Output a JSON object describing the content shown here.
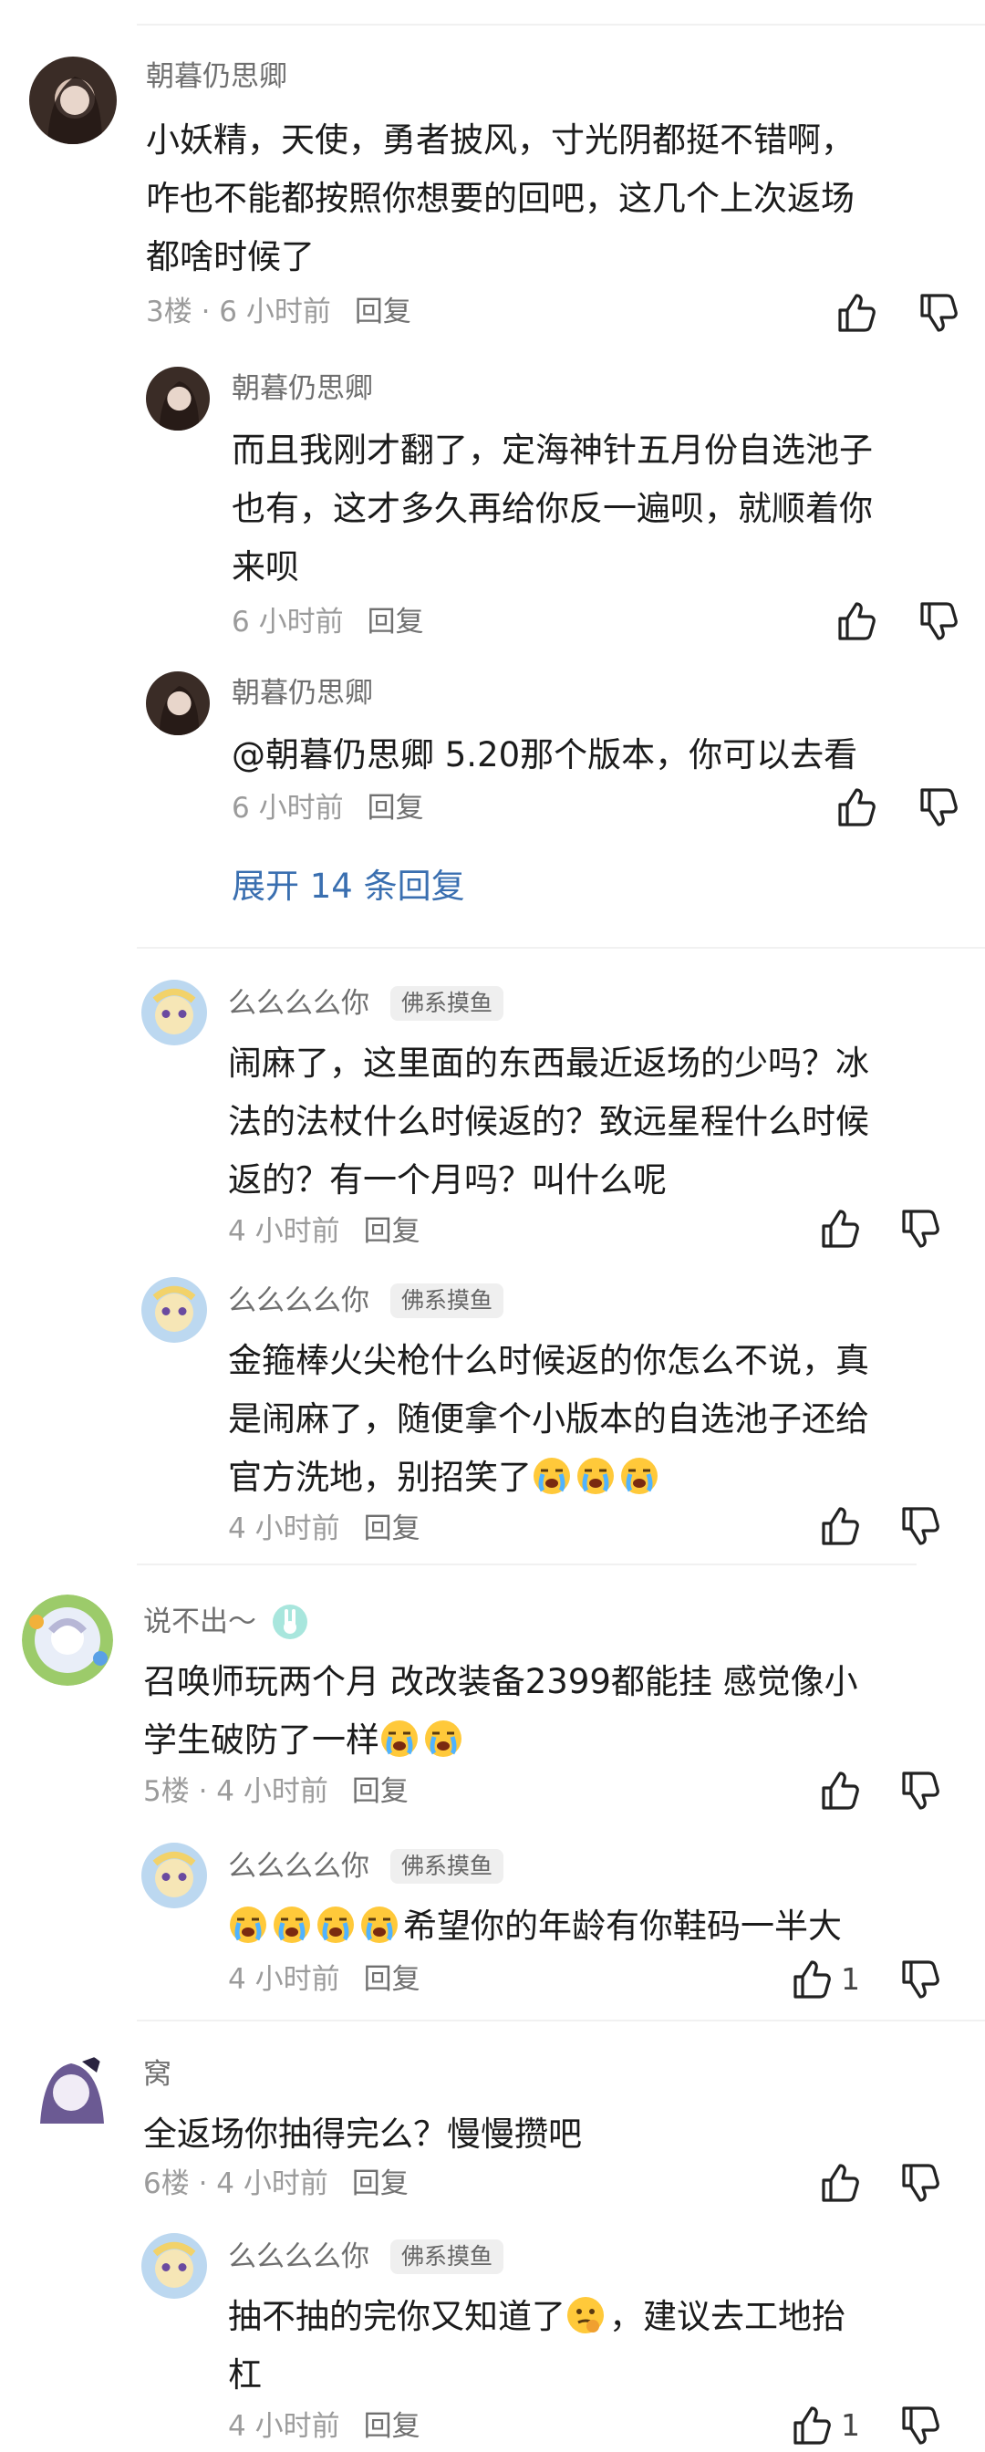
{
  "colors": {
    "link": "#3a6fb0",
    "meta": "#9b9b9b",
    "text": "#1b1b1b"
  },
  "comments": [
    {
      "user": "朝暮仍思卿",
      "lines": [
        "小妖精，天使，勇者披风，寸光阴都挺不错啊，",
        "咋也不能都按照你想要的回吧，这几个上次返场",
        "都啥时候了"
      ],
      "meta": "3楼 · 6 小时前",
      "reply_label": "回复",
      "replies": [
        {
          "user": "朝暮仍思卿",
          "lines": [
            "而且我刚才翻了，定海神针五月份自选池子",
            "也有，这才多久再给你反一遍呗，就顺着你",
            "来呗"
          ],
          "meta": "6 小时前",
          "reply_label": "回复"
        },
        {
          "user": "朝暮仍思卿",
          "lines": [
            "@朝暮仍思卿  5.20那个版本，你可以去看"
          ],
          "meta": "6 小时前",
          "reply_label": "回复"
        }
      ],
      "expand_label": "展开 14 条回复"
    },
    {
      "replies": [
        {
          "user": "么么么么你",
          "badge": "佛系摸鱼",
          "lines": [
            "闹麻了，这里面的东西最近返场的少吗？冰",
            "法的法杖什么时候返的？致远星程什么时候",
            "返的？有一个月吗？叫什么呢"
          ],
          "meta": "4 小时前",
          "reply_label": "回复"
        },
        {
          "user": "么么么么你",
          "badge": "佛系摸鱼",
          "lines": [
            "金箍棒火尖枪什么时候返的你怎么不说，真",
            "是闹麻了，随便拿个小版本的自选池子还给",
            "官方洗地，别招笑了"
          ],
          "emoji": [
            "crying-face",
            "crying-face",
            "crying-face"
          ],
          "meta": "4 小时前",
          "reply_label": "回复"
        }
      ]
    },
    {
      "user": "说不出～",
      "badge_icon": "rabbit-badge-icon",
      "lines": [
        "召唤师玩两个月 改改装备2399都能挂 感觉像小",
        "学生破防了一样"
      ],
      "emoji": [
        "crying-face",
        "crying-face"
      ],
      "meta": "5楼 · 4 小时前",
      "reply_label": "回复",
      "replies": [
        {
          "user": "么么么么你",
          "badge": "佛系摸鱼",
          "lines": [
            "希望你的年龄有你鞋码一半大"
          ],
          "lead_emoji": [
            "crying-face",
            "crying-face",
            "crying-face",
            "crying-face"
          ],
          "meta": "4 小时前",
          "reply_label": "回复",
          "likes": "1"
        }
      ]
    },
    {
      "user": "窝",
      "lines": [
        "全返场你抽得完么？慢慢攒吧"
      ],
      "meta": "6楼 · 4 小时前",
      "reply_label": "回复",
      "replies": [
        {
          "user": "么么么么你",
          "badge": "佛系摸鱼",
          "lines_a": "抽不抽的完你又知道了",
          "inline_emoji": "thinking-face",
          "lines_b": "，建议去工地抬",
          "lines": [
            "杠"
          ],
          "meta": "4 小时前",
          "reply_label": "回复",
          "likes": "1"
        }
      ]
    }
  ]
}
